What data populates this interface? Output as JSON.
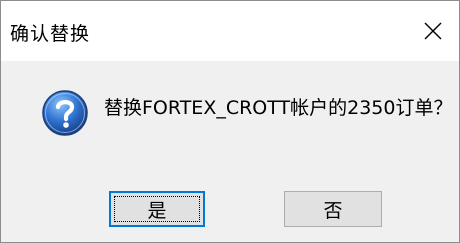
{
  "dialog": {
    "title": "确认替换",
    "message": "替换FORTEX_CROTT帐户的2350订单？",
    "icon": "question-icon",
    "close_icon": "close-icon",
    "buttons": {
      "yes_label": "是",
      "no_label": "否"
    }
  },
  "colors": {
    "title_bg": "#ffffff",
    "body_bg": "#f0f0f0",
    "button_bg": "#e1e1e1",
    "button_focus_border": "#0078d7",
    "icon_blue": "#2a6fc9"
  }
}
